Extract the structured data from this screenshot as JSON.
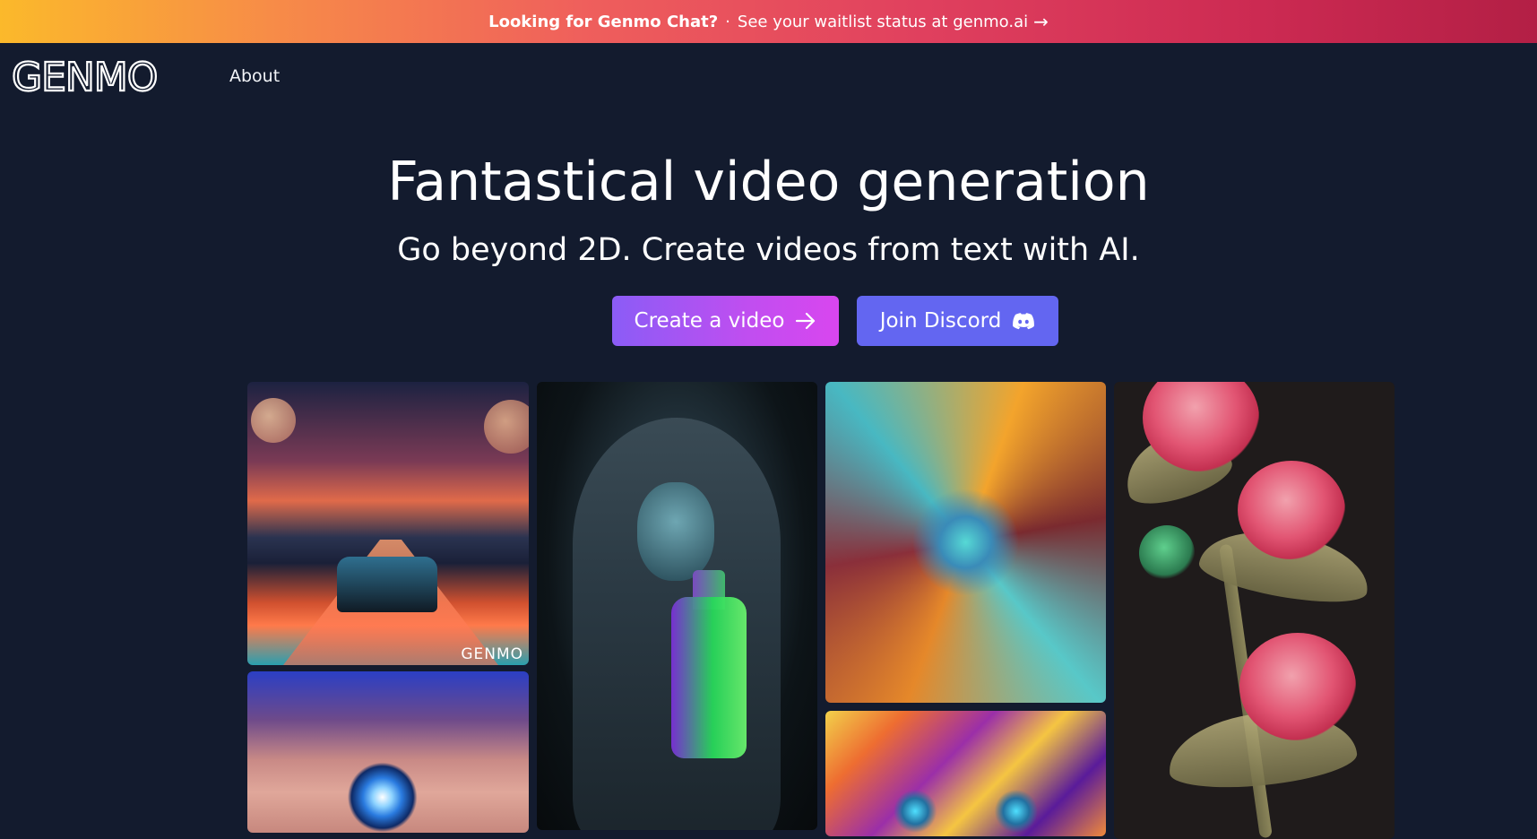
{
  "banner": {
    "lead": "Looking for Genmo Chat?",
    "separator": "·",
    "message": "See your waitlist status at genmo.ai",
    "arrow": "→"
  },
  "nav": {
    "logo_text": "GENMO",
    "about_label": "About"
  },
  "hero": {
    "title": "Fantastical video generation",
    "subtitle": "Go beyond 2D. Create videos from text with AI."
  },
  "buttons": {
    "create_label": "Create a video",
    "discord_label": "Join Discord"
  },
  "gallery": {
    "tile1_watermark": "GENMO"
  },
  "colors": {
    "background": "#131b2e",
    "create_button_from": "#8b5cf6",
    "create_button_to": "#d946ef",
    "discord_button": "#6366f1",
    "banner_from": "#fbb92b",
    "banner_to": "#b31f45"
  },
  "icons": {
    "create_button": "arrow-right-icon",
    "discord_button": "discord-icon"
  }
}
